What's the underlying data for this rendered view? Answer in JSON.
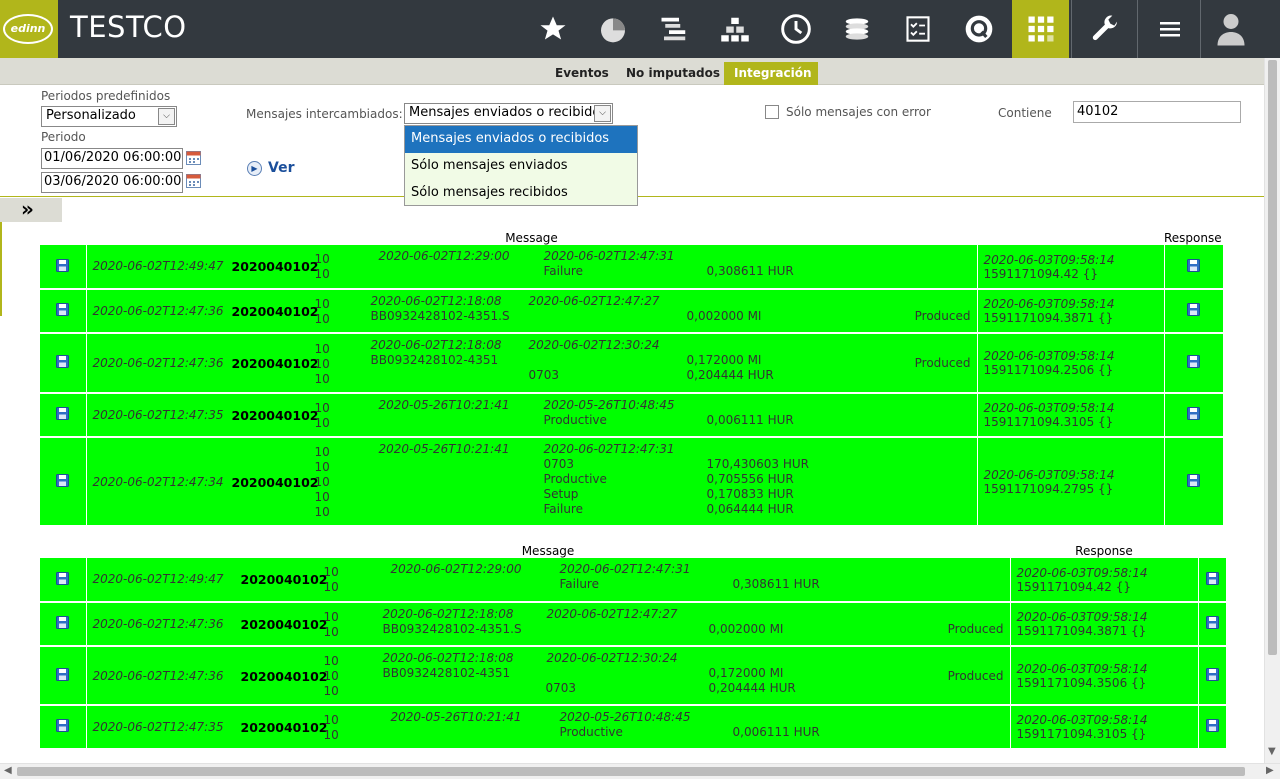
{
  "app": {
    "brand": "TESTCO",
    "logo_text": "edinn"
  },
  "toolbar": {
    "icons": [
      "star-icon",
      "pie-chart-icon",
      "gantt-icon",
      "hierarchy-icon",
      "clock-icon",
      "coins-icon",
      "checklist-icon",
      "q-icon",
      "grid-icon",
      "wrench-icon",
      "menu-icon",
      "user-icon"
    ],
    "active": "grid-icon"
  },
  "tabs": [
    {
      "label": "Eventos",
      "active": false
    },
    {
      "label": "No imputados",
      "active": false
    },
    {
      "label": "Integración",
      "active": true
    }
  ],
  "filters": {
    "periods_label": "Periodos predefinidos",
    "periods_value": "Personalizado",
    "period_label": "Periodo",
    "date_from": "01/06/2020 06:00:00",
    "date_to": "03/06/2020 06:00:00",
    "messages_label": "Mensajes intercambiados:",
    "messages_value": "Mensajes enviados o recibidos",
    "messages_options": [
      "Mensajes enviados o recibidos",
      "Sólo mensajes enviados",
      "Sólo mensajes recibidos"
    ],
    "only_errors_label": "Sólo mensajes con error",
    "contains_label": "Contiene",
    "contains_value": "40102",
    "ver_label": "Ver",
    "collapse_label": "»"
  },
  "tables": [
    {
      "header_message": "Message",
      "header_response": "Response",
      "rows": [
        {
          "ts": "2020-06-02T12:49:47",
          "code": "2020040102",
          "tens": [
            "10",
            "10"
          ],
          "a1": "",
          "a2": "",
          "b1": "2020-06-02T12:29:00",
          "c1": "2020-06-02T12:47:31",
          "c2": "Failure",
          "c3": "",
          "c4": "",
          "d1": "0,308611 HUR",
          "d2": "",
          "d3": "",
          "d4": "",
          "prod": "",
          "resp_ts": "2020-06-03T09:58:14",
          "resp_v": "1591171094.42 {}"
        },
        {
          "ts": "2020-06-02T12:47:36",
          "code": "2020040102",
          "tens": [
            "10",
            "10"
          ],
          "a1": "2020-06-02T12:18:08",
          "a2": "BB0932428102-4351.S",
          "b1": "2020-06-02T12:47:27",
          "c1": "",
          "c2": "",
          "c3": "",
          "c4": "",
          "d1": "0,002000 MI",
          "d2": "",
          "d3": "",
          "d4": "",
          "prod": "Produced",
          "resp_ts": "2020-06-03T09:58:14",
          "resp_v": "1591171094.3871 {}"
        },
        {
          "ts": "2020-06-02T12:47:36",
          "code": "2020040102",
          "tens": [
            "10",
            "10",
            "10"
          ],
          "a1": "2020-06-02T12:18:08",
          "a2": "BB0932428102-4351",
          "b1": "2020-06-02T12:30:24",
          "c1": "",
          "c2": "0703",
          "c3": "",
          "c4": "",
          "d1": "0,172000 MI",
          "d2": "0,204444 HUR",
          "d3": "",
          "d4": "",
          "prod": "Produced",
          "resp_ts": "2020-06-03T09:58:14",
          "resp_v": "1591171094.2506 {}"
        },
        {
          "ts": "2020-06-02T12:47:35",
          "code": "2020040102",
          "tens": [
            "10",
            "10"
          ],
          "a1": "",
          "a2": "",
          "b1": "2020-05-26T10:21:41",
          "c1": "2020-05-26T10:48:45",
          "c2": "Productive",
          "c3": "",
          "c4": "",
          "d1": "0,006111 HUR",
          "d2": "",
          "d3": "",
          "d4": "",
          "prod": "",
          "resp_ts": "2020-06-03T09:58:14",
          "resp_v": "1591171094.3105 {}"
        },
        {
          "ts": "2020-06-02T12:47:34",
          "code": "2020040102",
          "tens": [
            "10",
            "10",
            "10",
            "10",
            "10"
          ],
          "a1": "",
          "a2": "",
          "b1": "2020-05-26T10:21:41",
          "c1": "2020-06-02T12:47:31",
          "c2": "0703",
          "c3": "Productive",
          "c4": "Setup",
          "c5": "Failure",
          "d1": "170,430603 HUR",
          "d2": "0,705556 HUR",
          "d3": "0,170833 HUR",
          "d4": "0,064444 HUR",
          "prod": "",
          "resp_ts": "2020-06-03T09:58:14",
          "resp_v": "1591171094.2795 {}"
        }
      ]
    },
    {
      "header_message": "Message",
      "header_response": "Response",
      "rows": [
        {
          "ts": "2020-06-02T12:49:47",
          "code": "2020040102",
          "tens": [
            "10",
            "10"
          ],
          "a1": "",
          "a2": "",
          "b1": "2020-06-02T12:29:00",
          "c1": "2020-06-02T12:47:31",
          "c2": "Failure",
          "c3": "",
          "c4": "",
          "d1": "0,308611 HUR",
          "d2": "",
          "d3": "",
          "d4": "",
          "prod": "",
          "resp_ts": "2020-06-03T09:58:14",
          "resp_v": "1591171094.42 {}"
        },
        {
          "ts": "2020-06-02T12:47:36",
          "code": "2020040102",
          "tens": [
            "10",
            "10"
          ],
          "a1": "2020-06-02T12:18:08",
          "a2": "BB0932428102-4351.S",
          "b1": "2020-06-02T12:47:27",
          "c1": "",
          "c2": "",
          "c3": "",
          "c4": "",
          "d1": "0,002000 MI",
          "d2": "",
          "d3": "",
          "d4": "",
          "prod": "Produced",
          "resp_ts": "2020-06-03T09:58:14",
          "resp_v": "1591171094.3871 {}"
        },
        {
          "ts": "2020-06-02T12:47:36",
          "code": "2020040102",
          "tens": [
            "10",
            "10",
            "10"
          ],
          "a1": "2020-06-02T12:18:08",
          "a2": "BB0932428102-4351",
          "b1": "2020-06-02T12:30:24",
          "c1": "",
          "c2": "0703",
          "c3": "",
          "c4": "",
          "d1": "0,172000 MI",
          "d2": "0,204444 HUR",
          "d3": "",
          "d4": "",
          "prod": "Produced",
          "resp_ts": "2020-06-03T09:58:14",
          "resp_v": "1591171094.3506 {}"
        },
        {
          "ts": "2020-06-02T12:47:35",
          "code": "2020040102",
          "tens": [
            "10",
            "10"
          ],
          "a1": "",
          "a2": "",
          "b1": "2020-05-26T10:21:41",
          "c1": "2020-05-26T10:48:45",
          "c2": "Productive",
          "c3": "",
          "c4": "",
          "d1": "0,006111 HUR",
          "d2": "",
          "d3": "",
          "d4": "",
          "prod": "",
          "resp_ts": "2020-06-03T09:58:14",
          "resp_v": "1591171094.3105 {}"
        }
      ]
    }
  ]
}
